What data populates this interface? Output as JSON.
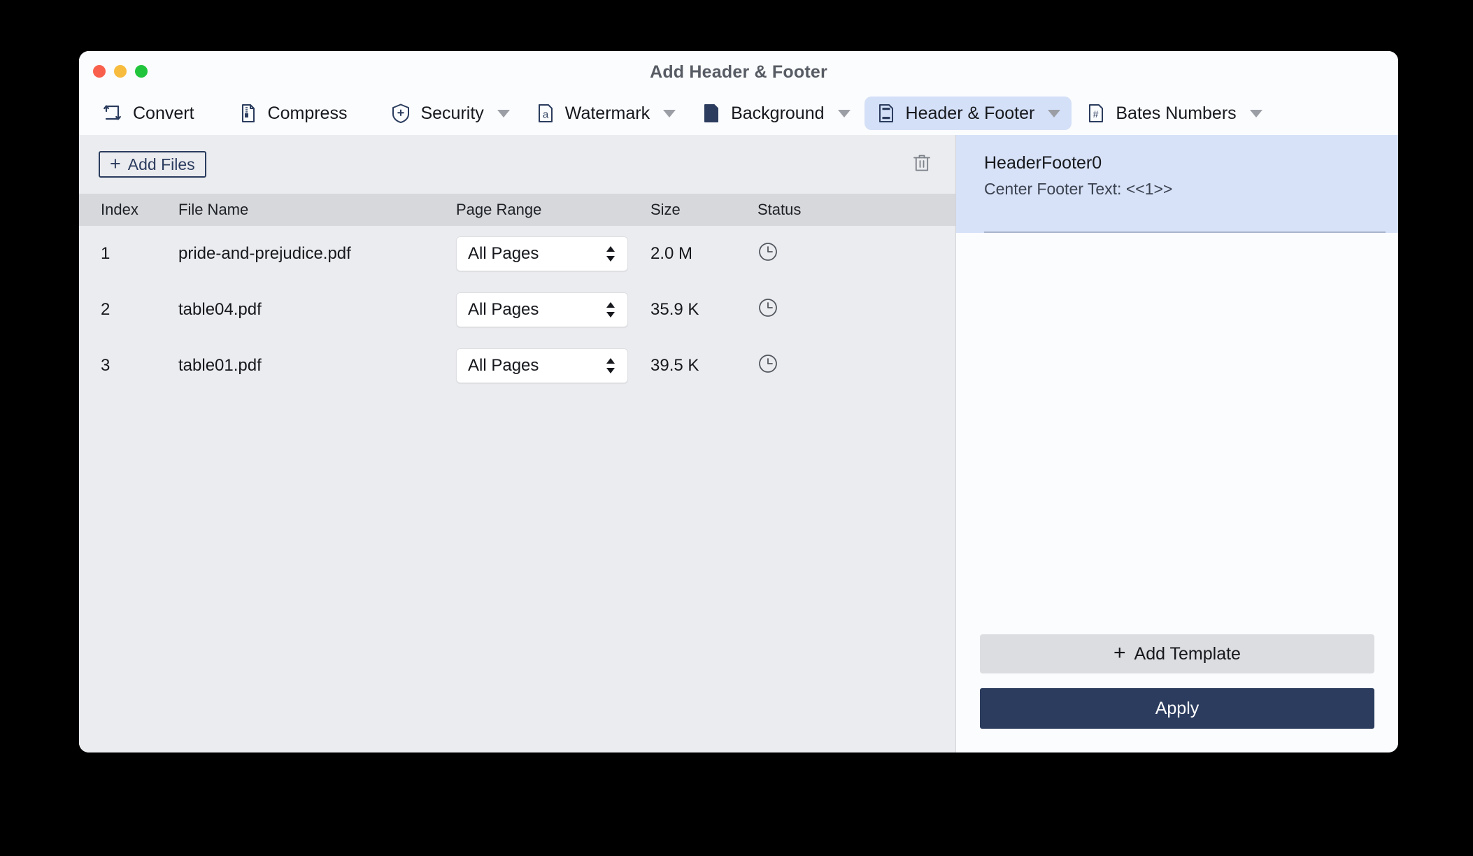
{
  "window": {
    "title": "Add Header & Footer",
    "controls": {
      "close": "close",
      "minimize": "minimize",
      "zoom": "zoom"
    }
  },
  "toolbar": {
    "items": [
      {
        "label": "Convert",
        "icon": "convert-icon",
        "has_caret": false,
        "active": false
      },
      {
        "label": "Compress",
        "icon": "compress-icon",
        "has_caret": false,
        "active": false
      },
      {
        "label": "Security",
        "icon": "shield-plus-icon",
        "has_caret": true,
        "active": false
      },
      {
        "label": "Watermark",
        "icon": "watermark-icon",
        "has_caret": true,
        "active": false
      },
      {
        "label": "Background",
        "icon": "background-icon",
        "has_caret": true,
        "active": false
      },
      {
        "label": "Header & Footer",
        "icon": "header-footer-icon",
        "has_caret": true,
        "active": true
      },
      {
        "label": "Bates Numbers",
        "icon": "bates-numbers-icon",
        "has_caret": true,
        "active": false
      }
    ]
  },
  "file_list": {
    "add_files_label": "Add Files",
    "add_files_plus": "+",
    "delete_icon": "trash-icon",
    "columns": [
      "Index",
      "File Name",
      "Page Range",
      "Size",
      "Status"
    ],
    "rows": [
      {
        "index": "1",
        "name": "pride-and-prejudice.pdf",
        "page_range": "All Pages",
        "size": "2.0 M",
        "status_icon": "clock-icon"
      },
      {
        "index": "2",
        "name": "table04.pdf",
        "page_range": "All Pages",
        "size": "35.9 K",
        "status_icon": "clock-icon"
      },
      {
        "index": "3",
        "name": "table01.pdf",
        "page_range": "All Pages",
        "size": "39.5 K",
        "status_icon": "clock-icon"
      }
    ]
  },
  "templates_panel": {
    "items": [
      {
        "name": "HeaderFooter0",
        "detail": "Center Footer Text:  <<1>>",
        "selected": true
      }
    ],
    "add_template_label": "Add Template",
    "add_template_plus": "+",
    "apply_label": "Apply"
  },
  "colors": {
    "accent": "#2b3c5e",
    "selection": "#d7e2f8",
    "toolbar_active": "#d4e0f7",
    "list_bg": "#ebecef",
    "header_bg": "#d6d8dc"
  }
}
